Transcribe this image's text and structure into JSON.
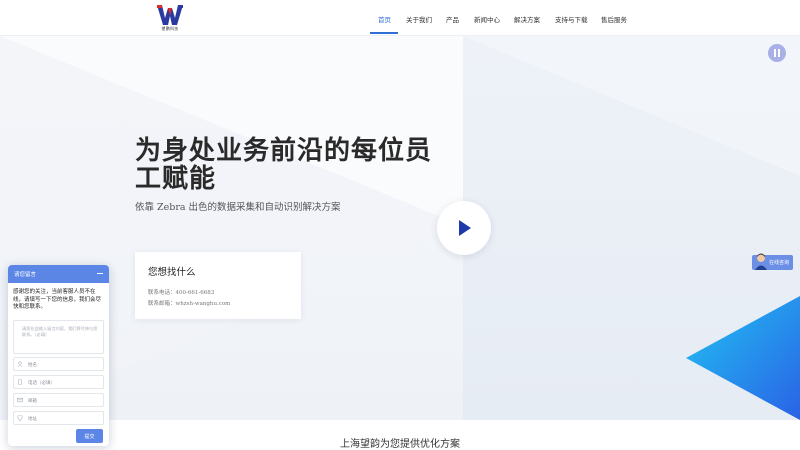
{
  "header": {
    "logo_text": "望鹏科技",
    "nav": [
      {
        "label": "首页",
        "active": true
      },
      {
        "label": "关于我们"
      },
      {
        "label": "产品"
      },
      {
        "label": "新闻中心"
      },
      {
        "label": "解决方案"
      },
      {
        "label": "支持与下载"
      },
      {
        "label": "售后服务"
      }
    ]
  },
  "hero": {
    "title": "为身处业务前沿的每位员工赋能",
    "subtitle": "依靠 Zebra 出色的数据采集和自动识别解决方案",
    "play_icon": "play-icon",
    "pause_icon": "pause-icon"
  },
  "contact_card": {
    "title": "您想找什么",
    "phone": "联系电话：400-661-6683",
    "email": "联系邮箱：whzsh-wanghu.com"
  },
  "online_service": {
    "label": "在线咨询"
  },
  "footer": {
    "title": "上海望韵为您提供优化方案"
  },
  "chat": {
    "header_title": "请您留言",
    "message": "感谢您的关注，当前客服人员不在线，请填写一下您的信息，我们会尽快和您联系。",
    "textarea_placeholder": "请您在此输入留言内容，我们将尽快与您联系。（必填）",
    "fields": [
      {
        "placeholder": "姓名",
        "icon": "user-icon"
      },
      {
        "placeholder": "电话（必填）",
        "icon": "phone-icon"
      },
      {
        "placeholder": "邮箱",
        "icon": "mail-icon"
      },
      {
        "placeholder": "地址",
        "icon": "location-icon"
      }
    ],
    "submit_label": "提交"
  },
  "colors": {
    "accent": "#2f6fd6",
    "chat_blue": "#5b86e5",
    "triangle_cyan": "#1fb6f0",
    "triangle_blue": "#2a6fe6"
  }
}
